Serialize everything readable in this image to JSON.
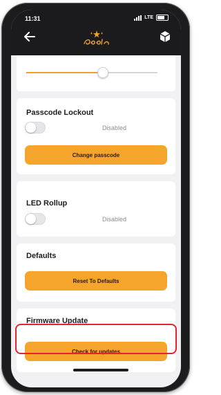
{
  "status_bar": {
    "time": "11:31",
    "network": "LTE"
  },
  "header": {
    "back_icon": "arrow-left-icon",
    "logo_text": "CoolPlay",
    "cube_icon": "cube-icon"
  },
  "slider": {
    "value_fraction": 0.58
  },
  "passcode": {
    "title": "Passcode Lockout",
    "status": "Disabled",
    "button": "Change passcode"
  },
  "led": {
    "title": "LED Rollup",
    "status": "Disabled"
  },
  "defaults": {
    "title": "Defaults",
    "button": "Reset To Defaults"
  },
  "firmware": {
    "title": "Firmware Update",
    "button": "Check for updates"
  },
  "colors": {
    "accent": "#f5a42c",
    "highlight": "#e0252e",
    "header": "#1b1b1d"
  }
}
